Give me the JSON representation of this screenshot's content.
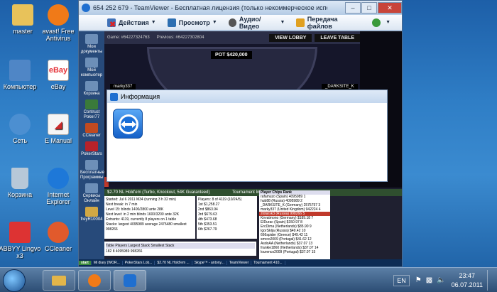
{
  "desktop": {
    "icons": [
      {
        "label": "master",
        "color": "#e8c25a"
      },
      {
        "label": "avast! Free Antivirus",
        "color": "#f07a18"
      },
      {
        "label": "Компьютер",
        "color": "#4f86c6"
      },
      {
        "label": "eBay",
        "color": "#e53238"
      },
      {
        "label": "Сеть",
        "color": "#4c8fd1"
      },
      {
        "label": "E Manual",
        "color": "#cc2a2a"
      },
      {
        "label": "Корзина",
        "color": "#b7c8d8"
      },
      {
        "label": "Internet Explorer",
        "color": "#1e78d8"
      },
      {
        "label": "ABBYY Lingvo x3",
        "color": "#d33"
      },
      {
        "label": "CCleaner",
        "color": "#e15a2c"
      }
    ]
  },
  "teamviewer": {
    "title": "654 252 679 - TeamViewer - Бесплатная лицензия (только некоммерческое использование)",
    "toolbar": {
      "actions": "Действия",
      "view": "Просмотр",
      "audio_video": "Аудио/Видео",
      "file_transfer": "Передача файлов"
    },
    "remote_sidebar": [
      "Мои документы",
      "Мой компьютер",
      "Корзина",
      "Contrust Poker77",
      "CCleaner",
      "PokerStars",
      "Бесплатные Программы",
      "Сервисы Онлайн",
      "freyR10004"
    ],
    "poker": {
      "table_header": "Game: #64227324763",
      "previous": "Previous: #64227302804",
      "view_lobby": "VIEW LOBBY",
      "leave_table": "LEAVE TABLE",
      "pot": "POT $420,000",
      "player_left": "marky337",
      "player_right": "_DARKSITE_K",
      "lobby_title": "$2.70 NL Hold'em (Turbo, Knockout, 54K Guaranteed)",
      "tournament_info": "Tournament Info",
      "info_lines": [
        "Started: Jul 6 2011 M34 (running 3 h 32 min)",
        "Next break: in 7 min",
        "Level 15: blinds 1400/2800 ante 28K",
        "Next level: in 2 min blinds 1600/3200 ante 32K",
        "Entrants: 4119, currently 8 players on 1 table",
        "Stacks: largest 4095989 average 2475480 smallest 998266"
      ],
      "stats_head": "Players: 8 of 4119 (10/24/5)",
      "payouts": [
        {
          "place": "1st",
          "amount": "$1,258.27"
        },
        {
          "place": "2nd",
          "amount": "$863.94"
        },
        {
          "place": "3rd",
          "amount": "$679.63"
        },
        {
          "place": "4th",
          "amount": "$473.68"
        },
        {
          "place": "5th",
          "amount": "$353.51"
        },
        {
          "place": "6th",
          "amount": "$267.79"
        }
      ],
      "players_list": [
        "Player Chips Rank",
        "rafamuzo (Spain) 4095989 1",
        "hub88 (Russia) 4095989 2",
        "_DARKSITE_K (Germany) 2575757 3",
        "marky337 (United Kingdom) 942224 4",
        "zlotarsk3 (Russia) 998266 5",
        "Kirvatmono (Germany) $189.18 7",
        "ElDurac (Spain) $150.97 8",
        "ErcDima (Netherlands) $85.90 9",
        "IgorSkIja (Russia) $49.42 10",
        "666spider (Greece) $49.42 11",
        "smrco2009 (Portugal) $41.62 12",
        "AsdoAA (Netherlands) $37.07 13",
        "frankie1860 (Netherlands) $37.07 14",
        "lourenco2009 (Portugal) $37.07 15"
      ],
      "table_footer": "Table Players Largest Stack Smallest Stack",
      "table_row": "182 8 4095989 998266"
    },
    "remote_taskbar": [
      "start",
      "Mi diary (WOR...",
      "PokerStars Lob...",
      "$2.70 NL Hold'em ...",
      "Skype™ - antony...",
      "TeamViewer",
      "Tournament 410..."
    ]
  },
  "dialog": {
    "title": "Информация"
  },
  "taskbar": {
    "language": "EN",
    "time": "23:47",
    "date": "06.07.2011"
  }
}
